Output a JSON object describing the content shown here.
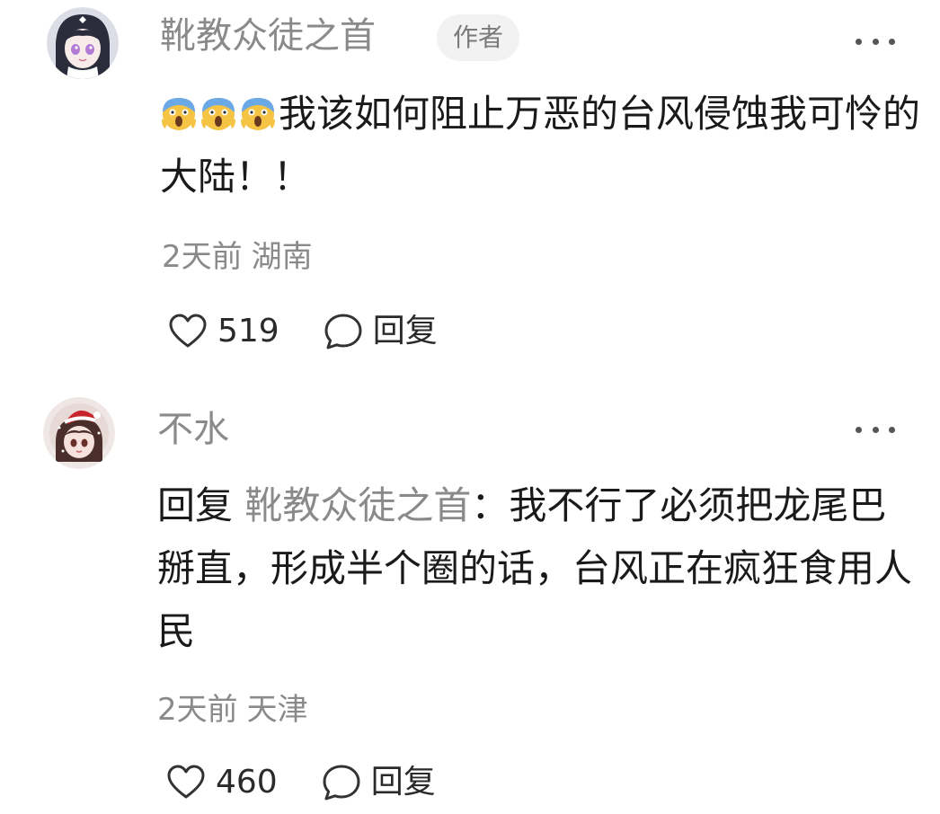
{
  "comments": [
    {
      "avatar_icon": "anime-girl-avatar-icon",
      "username": "靴教众徒之首",
      "badge": "作者",
      "emojis": [
        "scream-emoji",
        "scream-emoji",
        "scream-emoji"
      ],
      "text": "我该如何阻止万恶的台风侵蚀我可怜的大陆！！",
      "time": "2天前",
      "region": "湖南",
      "likes": "519",
      "reply_label": "回复"
    },
    {
      "avatar_icon": "anime-santa-hat-avatar-icon",
      "username": "不水",
      "reply_prefix": "回复",
      "reply_target": "靴教众徒之首",
      "text": "：我不行了必须把龙尾巴掰直，形成半个圈的话，台风正在疯狂食用人民",
      "time": "2天前",
      "region": "天津",
      "likes": "460",
      "reply_label": "回复"
    }
  ],
  "colors": {
    "text_primary": "#1a1a1a",
    "text_secondary": "#8a8a8a",
    "badge_bg": "#f2f2f2",
    "background": "#ffffff"
  }
}
